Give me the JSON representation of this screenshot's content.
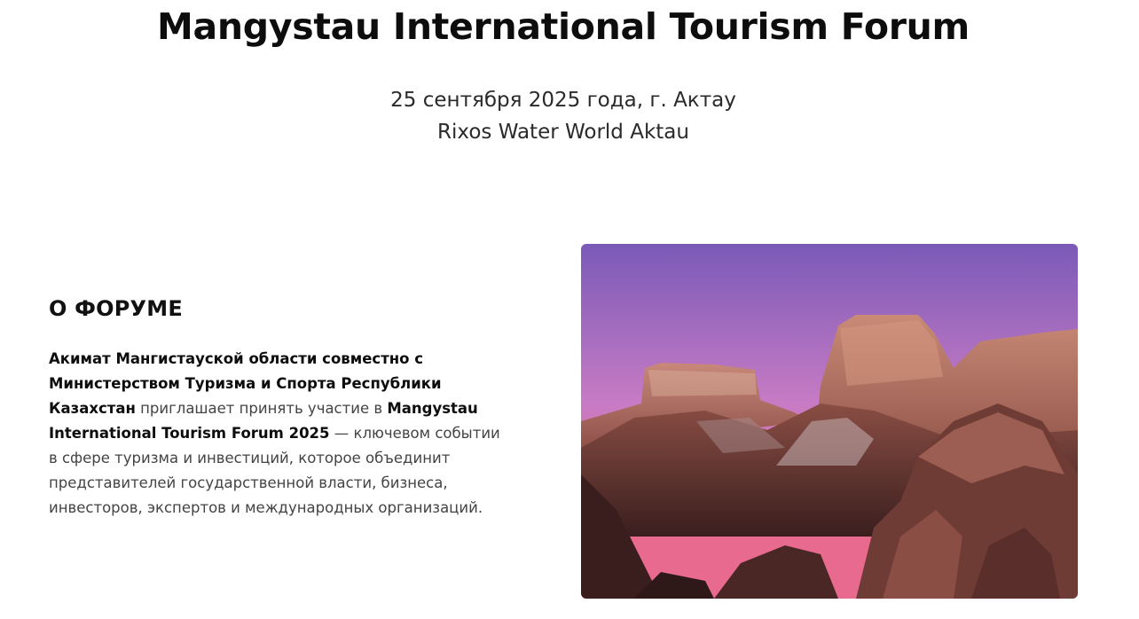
{
  "hero": {
    "title": "Mangystau International Tourism Forum",
    "date_line": "25 сентября 2025 года, г. Актау",
    "venue_line": "Rixos Water World Aktau"
  },
  "about": {
    "heading": "О ФОРУМЕ",
    "bold_lead": "Акимат Мангистауской области совместно с Министерством Туризма и Спорта Республики Казахстан",
    "text_mid": " приглашает принять участие в ",
    "bold_event": "Mangystau International Tourism Forum 2025",
    "text_tail": " — ключевом событии в сфере туризма и инвестиций, которое объединит представителей государственной власти, бизнеса, инвесторов, экспертов и международных организаций."
  },
  "photo": {
    "subject": "mangystau-canyon-landscape",
    "colors": {
      "sky_top": "#7a5ab8",
      "sky_mid": "#c77bc4",
      "sky_horizon": "#e86a8e",
      "rock_light": "#c98a76",
      "rock_mid": "#8a4e44",
      "rock_dark": "#3a1e1e"
    }
  }
}
